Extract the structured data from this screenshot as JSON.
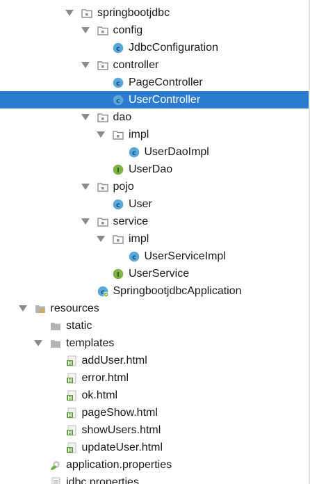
{
  "tree": {
    "items": [
      {
        "label": "springbootjdbc",
        "icon": "package-icon",
        "level": 0,
        "arrow": true
      },
      {
        "label": "config",
        "icon": "package-icon",
        "level": 1,
        "arrow": true
      },
      {
        "label": "JdbcConfiguration",
        "icon": "java-class-icon",
        "level": 2,
        "arrow": false
      },
      {
        "label": "controller",
        "icon": "package-icon",
        "level": 1,
        "arrow": true
      },
      {
        "label": "PageController",
        "icon": "java-class-icon",
        "level": 2,
        "arrow": false
      },
      {
        "label": "UserController",
        "icon": "java-class-icon",
        "level": 2,
        "arrow": false,
        "selected": true
      },
      {
        "label": "dao",
        "icon": "package-icon",
        "level": 1,
        "arrow": true
      },
      {
        "label": "impl",
        "icon": "package-icon",
        "level": 2,
        "arrow": true
      },
      {
        "label": "UserDaoImpl",
        "icon": "java-class-icon",
        "level": 3,
        "arrow": false
      },
      {
        "label": "UserDao",
        "icon": "java-interface-icon",
        "level": 2,
        "arrow": false
      },
      {
        "label": "pojo",
        "icon": "package-icon",
        "level": 1,
        "arrow": true
      },
      {
        "label": "User",
        "icon": "java-class-icon",
        "level": 2,
        "arrow": false
      },
      {
        "label": "service",
        "icon": "package-icon",
        "level": 1,
        "arrow": true
      },
      {
        "label": "impl",
        "icon": "package-icon",
        "level": 2,
        "arrow": true
      },
      {
        "label": "UserServiceImpl",
        "icon": "java-class-icon",
        "level": 3,
        "arrow": false
      },
      {
        "label": "UserService",
        "icon": "java-interface-icon",
        "level": 2,
        "arrow": false
      },
      {
        "label": "SpringbootjdbcApplication",
        "icon": "spring-boot-class-icon",
        "level": 1,
        "arrow": false
      },
      {
        "label": "resources",
        "icon": "resources-folder-icon",
        "level": -3,
        "arrow": true
      },
      {
        "label": "static",
        "icon": "folder-icon",
        "level": -2,
        "arrow": false
      },
      {
        "label": "templates",
        "icon": "folder-icon",
        "level": -2,
        "arrow": true
      },
      {
        "label": "addUser.html",
        "icon": "html-file-icon",
        "level": -1,
        "arrow": false
      },
      {
        "label": "error.html",
        "icon": "html-file-icon",
        "level": -1,
        "arrow": false
      },
      {
        "label": "ok.html",
        "icon": "html-file-icon",
        "level": -1,
        "arrow": false
      },
      {
        "label": "pageShow.html",
        "icon": "html-file-icon",
        "level": -1,
        "arrow": false
      },
      {
        "label": "showUsers.html",
        "icon": "html-file-icon",
        "level": -1,
        "arrow": false
      },
      {
        "label": "updateUser.html",
        "icon": "html-file-icon",
        "level": -1,
        "arrow": false
      },
      {
        "label": "application.properties",
        "icon": "spring-properties-icon",
        "level": -2,
        "arrow": false
      },
      {
        "label": "jdbc.properties",
        "icon": "properties-file-icon",
        "level": -2,
        "arrow": false
      }
    ]
  },
  "colors": {
    "selection": "#2b7bd0",
    "class_icon": "#5aa7d9",
    "interface_icon": "#7cb342",
    "folder": "#a9a9a9",
    "html_icon": "#5d9b3c"
  }
}
